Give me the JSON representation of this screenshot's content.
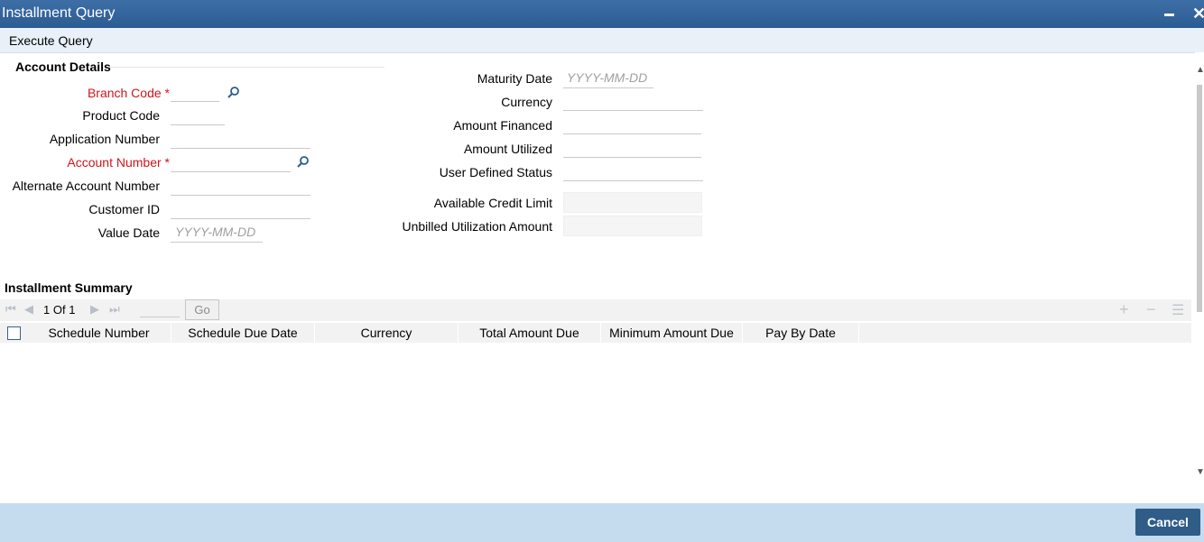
{
  "window": {
    "title": "Installment Query"
  },
  "menu": {
    "execute_query": "Execute Query"
  },
  "account_details": {
    "section_title": "Account Details",
    "branch_code": {
      "label": "Branch Code",
      "required": "*",
      "value": ""
    },
    "product_code": {
      "label": "Product Code",
      "value": ""
    },
    "application_number": {
      "label": "Application Number",
      "value": ""
    },
    "account_number": {
      "label": "Account Number",
      "required": "*",
      "value": ""
    },
    "alternate_account_number": {
      "label": "Alternate Account Number",
      "value": ""
    },
    "customer_id": {
      "label": "Customer ID",
      "value": ""
    },
    "value_date": {
      "label": "Value Date",
      "placeholder": "YYYY-MM-DD"
    },
    "maturity_date": {
      "label": "Maturity Date",
      "placeholder": "YYYY-MM-DD"
    },
    "currency": {
      "label": "Currency",
      "value": ""
    },
    "amount_financed": {
      "label": "Amount Financed",
      "value": ""
    },
    "amount_utilized": {
      "label": "Amount Utilized",
      "value": ""
    },
    "user_defined_status": {
      "label": "User Defined Status",
      "value": ""
    },
    "available_credit_limit": {
      "label": "Available Credit Limit",
      "value": ""
    },
    "unbilled_utilization_amount": {
      "label": "Unbilled Utilization Amount",
      "value": ""
    }
  },
  "installment_summary": {
    "section_title": "Installment Summary",
    "pager": {
      "current": "1",
      "of_label": "Of",
      "total": "1",
      "go_label": "Go"
    },
    "columns": [
      "Schedule Number",
      "Schedule Due Date",
      "Currency",
      "Total Amount Due",
      "Minimum Amount Due",
      "Pay By Date"
    ],
    "rows": []
  },
  "footer": {
    "cancel_label": "Cancel"
  },
  "colors": {
    "title_bar": "#2b5c93",
    "required": "#d2141a",
    "footer": "#c5dbee",
    "cancel_button": "#2f5d88"
  }
}
